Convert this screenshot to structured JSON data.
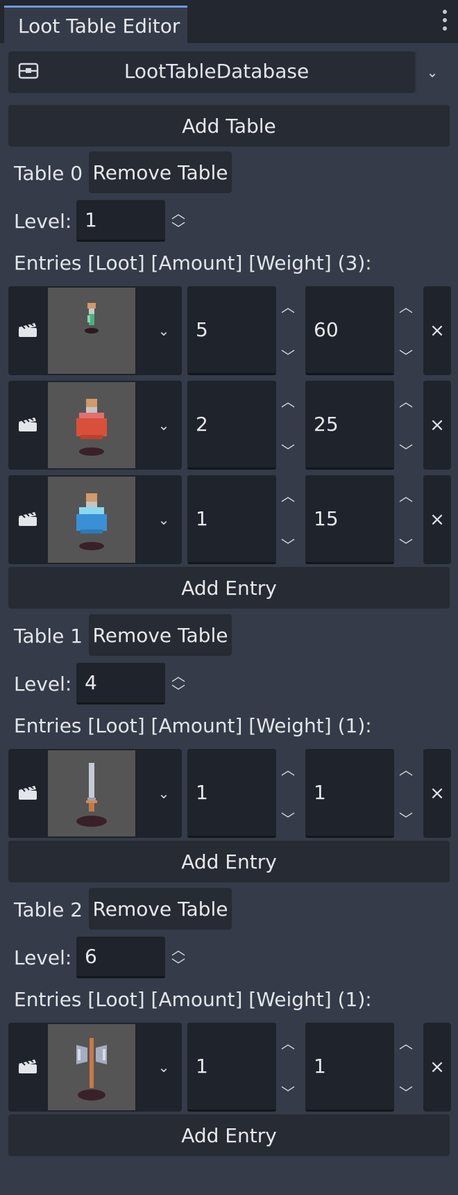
{
  "panel": {
    "title": "Loot Table Editor"
  },
  "resource": {
    "name": "LootTableDatabase",
    "icon": "database-icon",
    "dropdown_icon": "chevron-down-icon"
  },
  "add_table_label": "Add Table",
  "strings": {
    "remove_table": "Remove Table",
    "level_label": "Level:",
    "add_entry": "Add Entry",
    "remove_entry": "×"
  },
  "tables": [
    {
      "label": "Table 0",
      "level": "1",
      "entries_label": "Entries [Loot] [Amount] [Weight] (3):",
      "entries": [
        {
          "icon": "thin-green-potion-icon",
          "amount": "5",
          "weight": "60"
        },
        {
          "icon": "red-potion-icon",
          "amount": "2",
          "weight": "25"
        },
        {
          "icon": "blue-potion-icon",
          "amount": "1",
          "weight": "15"
        }
      ]
    },
    {
      "label": "Table 1",
      "level": "4",
      "entries_label": "Entries [Loot] [Amount] [Weight] (1):",
      "entries": [
        {
          "icon": "sword-icon",
          "amount": "1",
          "weight": "1"
        }
      ]
    },
    {
      "label": "Table 2",
      "level": "6",
      "entries_label": "Entries [Loot] [Amount] [Weight] (1):",
      "entries": [
        {
          "icon": "double-axe-icon",
          "amount": "1",
          "weight": "1"
        }
      ]
    }
  ]
}
